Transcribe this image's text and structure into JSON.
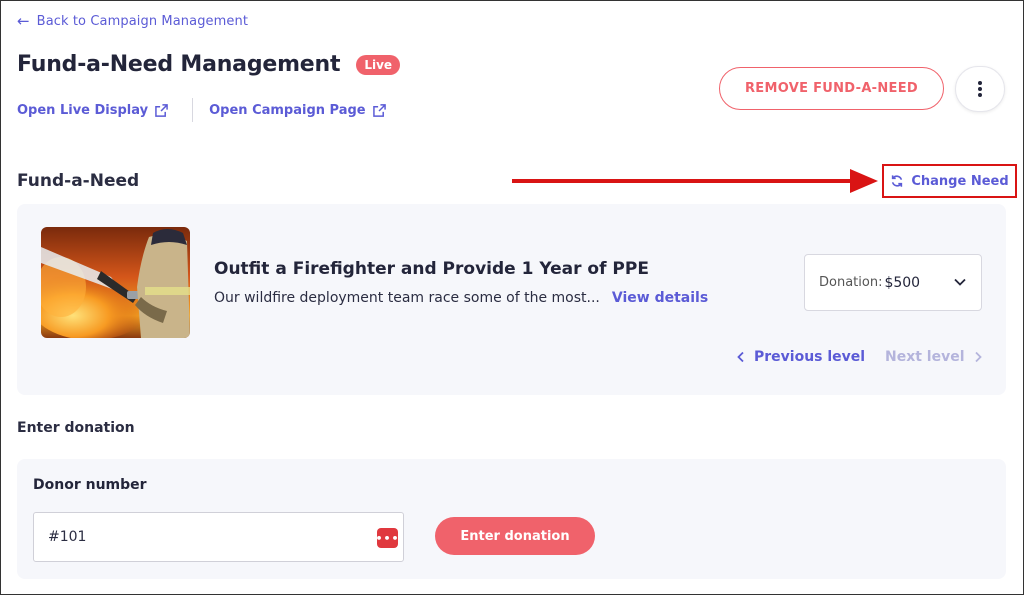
{
  "nav": {
    "back_label": "Back to Campaign Management"
  },
  "header": {
    "title": "Fund-a-Need Management",
    "status_badge": "Live",
    "open_live_display": "Open Live Display",
    "open_campaign_page": "Open Campaign Page",
    "remove_button": "REMOVE FUND-A-NEED"
  },
  "fund_a_need": {
    "section_title": "Fund-a-Need",
    "change_need_label": "Change Need",
    "need_title": "Outfit a Firefighter and Provide 1 Year of PPE",
    "need_description": "Our wildfire deployment team race some of the most...",
    "view_details": "View details",
    "donation_label": "Donation:",
    "donation_value": "$500",
    "previous_level": "Previous level",
    "next_level": "Next level"
  },
  "enter_donation": {
    "section_title": "Enter donation",
    "donor_label": "Donor number",
    "donor_value": "#101",
    "submit_label": "Enter donation"
  },
  "colors": {
    "accent": "#5b5bd6",
    "danger": "#f0626b",
    "annotation": "#d91414",
    "card_bg": "#f6f7fb"
  }
}
